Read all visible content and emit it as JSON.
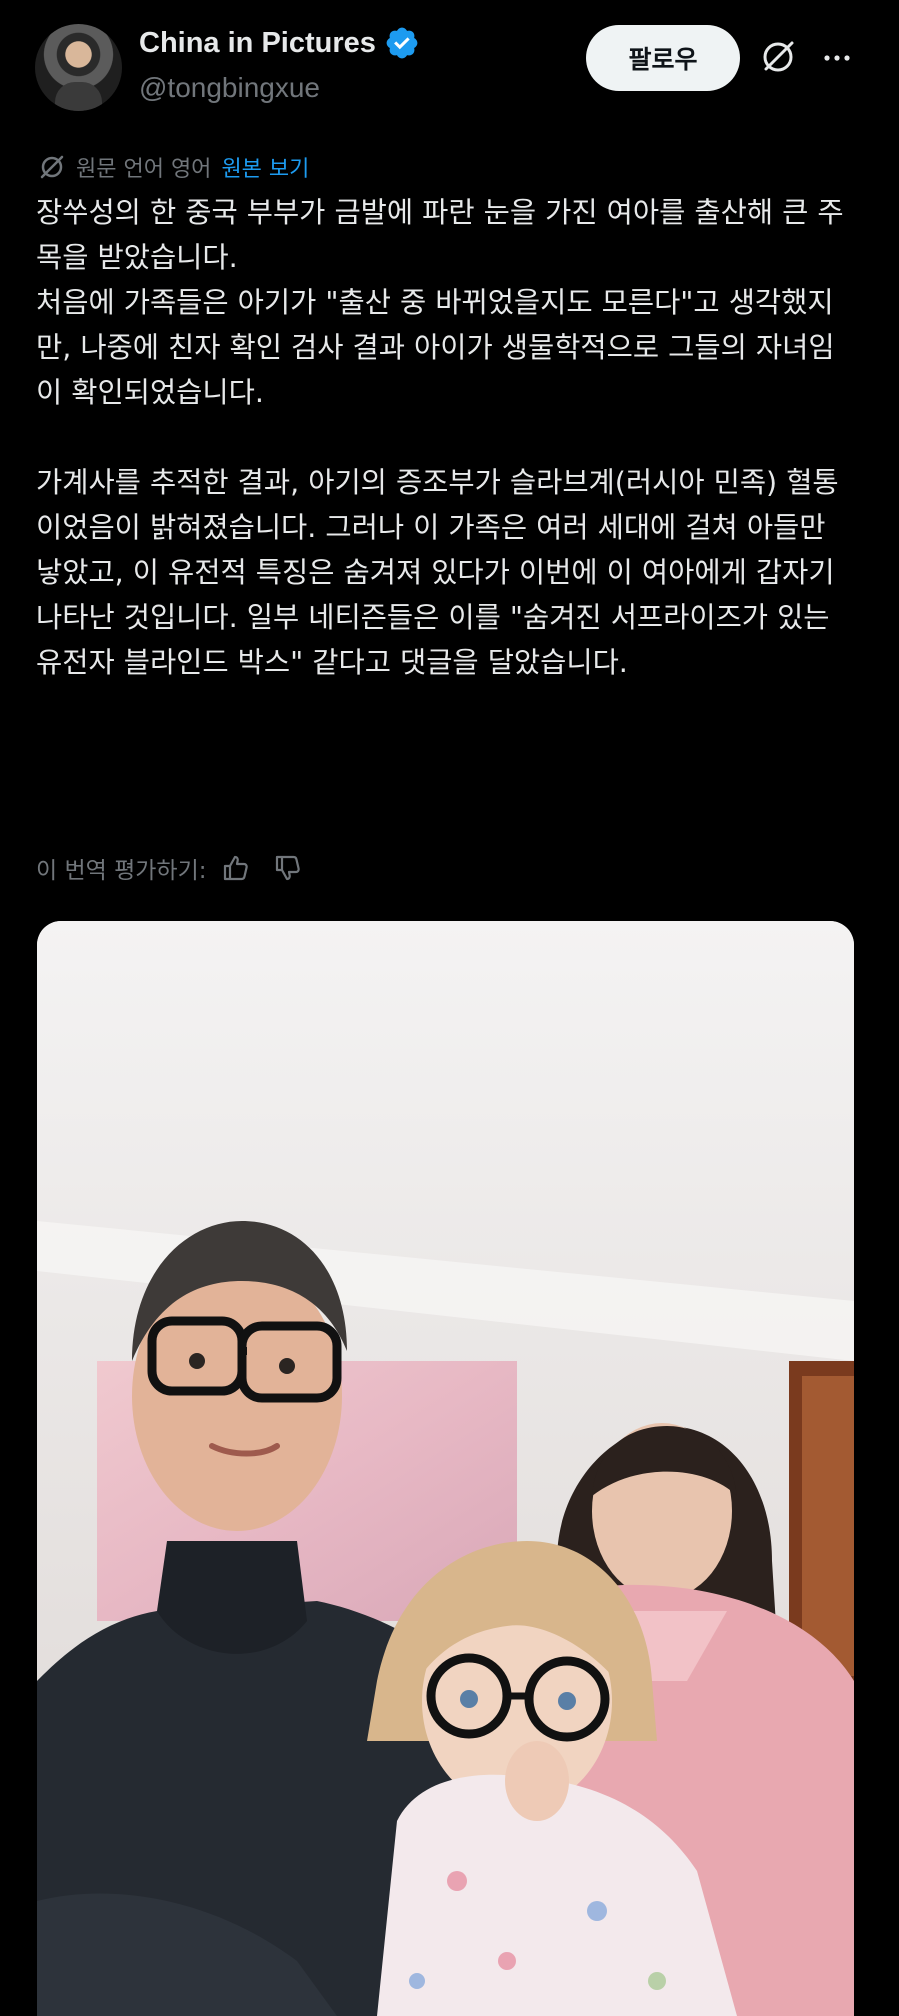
{
  "author": {
    "name": "China in Pictures",
    "handle": "@tongbingxue"
  },
  "actions": {
    "follow_label": "팔로우"
  },
  "translation": {
    "source_language": "원문 언어 영어",
    "view_original": "원본 보기"
  },
  "tweet": {
    "text": "장쑤성의 한 중국 부부가 금발에 파란 눈을 가진 여아를 출산해 큰 주목을 받았습니다.\n처음에 가족들은 아기가 \"출산 중 바뀌었을지도 모른다\"고 생각했지만, 나중에 친자 확인 검사 결과 아이가 생물학적으로 그들의 자녀임이 확인되었습니다.\n\n가계사를 추적한 결과, 아기의 증조부가 슬라브계(러시아 민족) 혈통이었음이 밝혀졌습니다. 그러나 이 가족은 여러 세대에 걸쳐 아들만 낳았고, 이 유전적 특징은 숨겨져 있다가 이번에 이 여아에게 갑자기 나타난 것입니다. 일부 네티즌들은 이를 \"숨겨진 서프라이즈가 있는 유전자 블라인드 박스\" 같다고 댓글을 달았습니다."
  },
  "rating": {
    "label": "이 번역 평가하기:"
  },
  "colors": {
    "background": "#000000",
    "text": "#e7e9ea",
    "secondary": "#71767b",
    "accent": "#1d9bf0",
    "follow_bg": "#eff3f4"
  },
  "icons": [
    "verified-badge-icon",
    "grok-icon",
    "more-icon",
    "translate-icon",
    "thumbs-up-icon",
    "thumbs-down-icon"
  ]
}
